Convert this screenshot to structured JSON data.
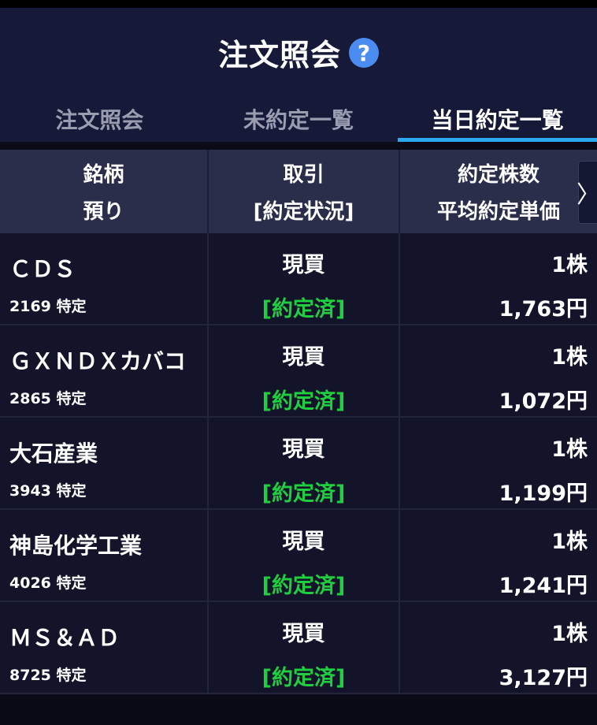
{
  "header": {
    "title": "注文照会",
    "help_icon": "question-circle-icon",
    "help_glyph": "?"
  },
  "tabs": [
    {
      "label": "注文照会",
      "active": false
    },
    {
      "label": "未約定一覧",
      "active": false
    },
    {
      "label": "当日約定一覧",
      "active": true
    }
  ],
  "columns": {
    "col1_line1": "銘柄",
    "col1_line2": "預り",
    "col2_line1": "取引",
    "col2_line2": "[約定状況]",
    "col3_line1": "約定株数",
    "col3_line2": "平均約定単価",
    "scroll_glyph": "〉"
  },
  "rows": [
    {
      "name": "ＣＤＳ",
      "code": "2169 特定",
      "trade": "現買",
      "status": "[約定済]",
      "qty": "1株",
      "price": "1,763円"
    },
    {
      "name": "ＧＸＮＤＸカバコ",
      "code": "2865 特定",
      "trade": "現買",
      "status": "[約定済]",
      "qty": "1株",
      "price": "1,072円"
    },
    {
      "name": "大石産業",
      "code": "3943 特定",
      "trade": "現買",
      "status": "[約定済]",
      "qty": "1株",
      "price": "1,199円"
    },
    {
      "name": "神島化学工業",
      "code": "4026 特定",
      "trade": "現買",
      "status": "[約定済]",
      "qty": "1株",
      "price": "1,241円"
    },
    {
      "name": "ＭＳ＆ＡＤ",
      "code": "8725 特定",
      "trade": "現買",
      "status": "[約定済]",
      "qty": "1株",
      "price": "3,127円"
    }
  ],
  "colors": {
    "accent": "#2aa8f0",
    "status_done": "#1fcf3f",
    "help_icon_bg": "#4a8cf0"
  }
}
